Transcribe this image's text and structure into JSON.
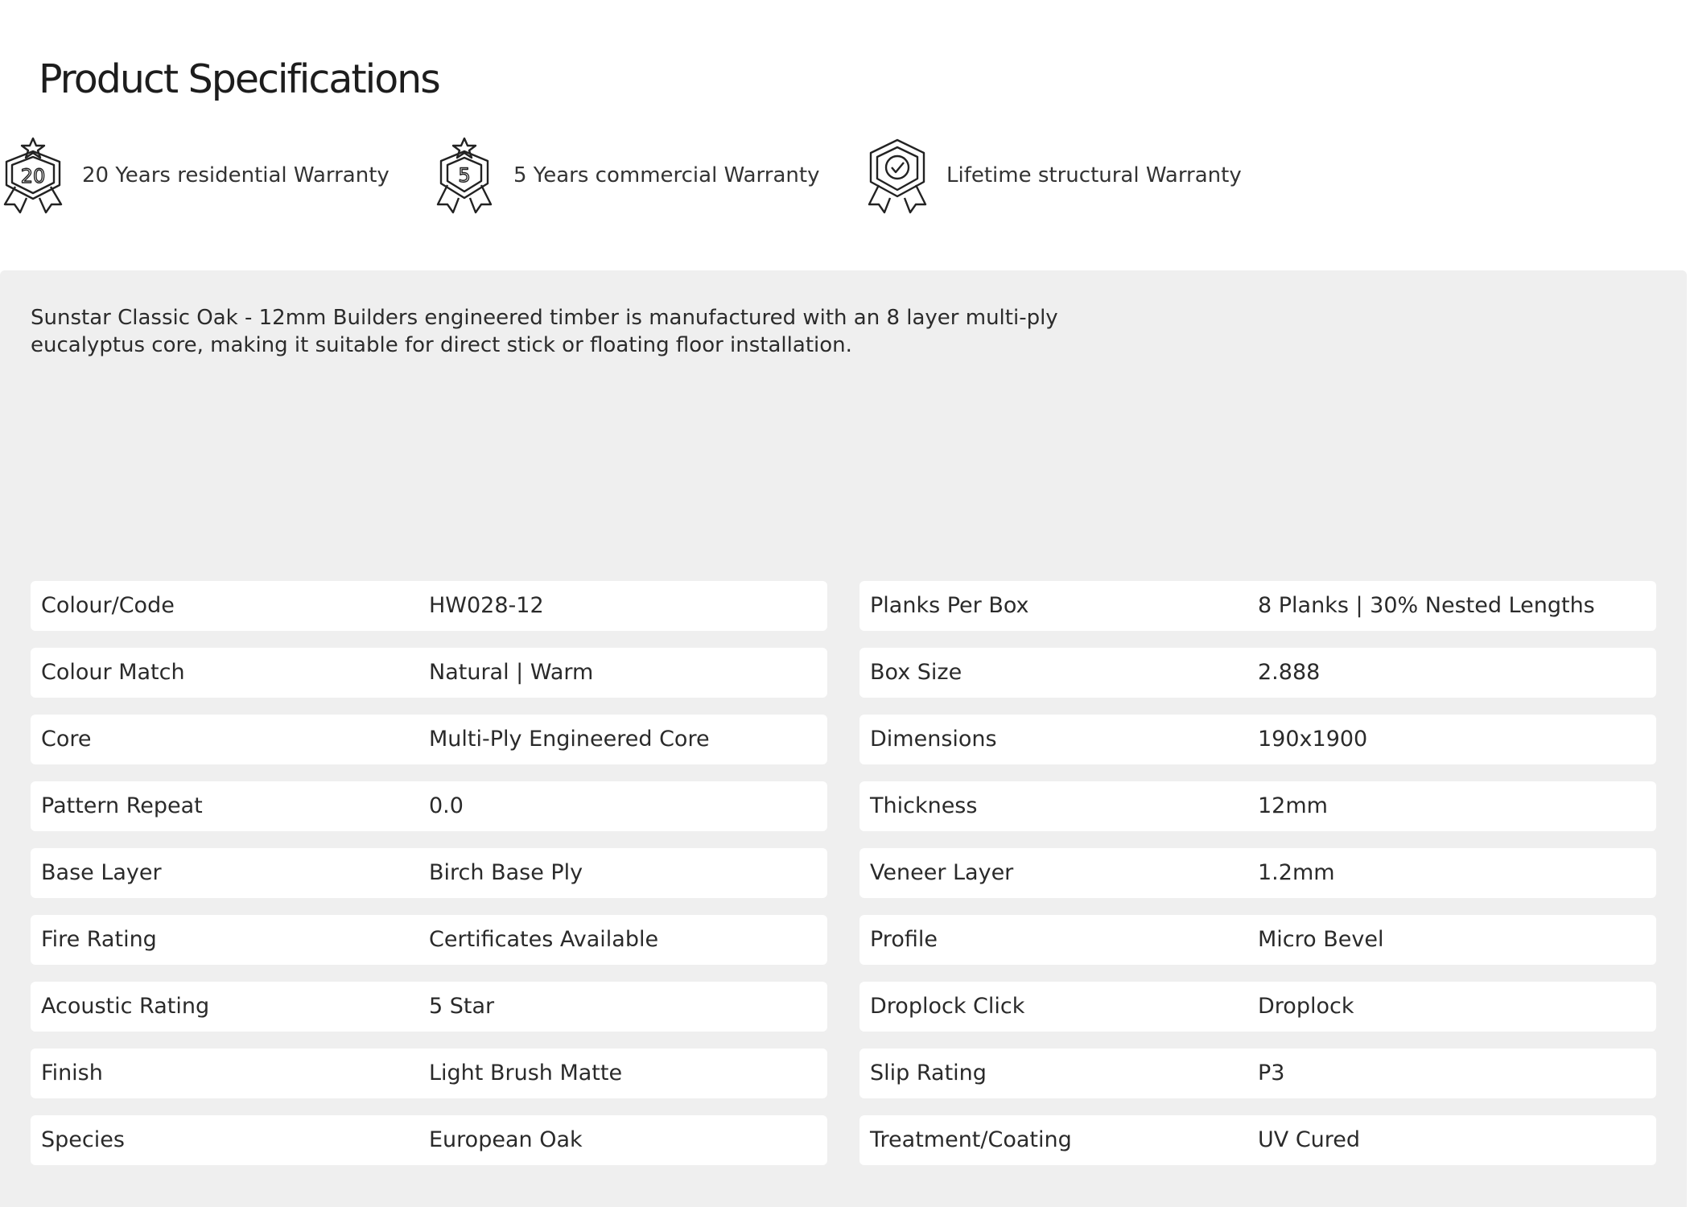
{
  "page": {
    "title": "Product Specifications"
  },
  "warranties": [
    {
      "icon": "ribbon-badge-20-icon",
      "badge_text": "20",
      "label": "20 Years residential Warranty"
    },
    {
      "icon": "ribbon-badge-5-icon",
      "badge_text": "5",
      "label": "5 Years commercial Warranty"
    },
    {
      "icon": "shield-check-badge-icon",
      "label": "Lifetime structural Warranty"
    }
  ],
  "description": "Sunstar Classic Oak - 12mm Builders engineered timber is manufactured with an 8 layer multi-ply eucalyptus core, making it suitable for direct stick or floating floor installation.",
  "specs": {
    "left": [
      {
        "label": "Colour/Code",
        "value": "HW028-12"
      },
      {
        "label": "Colour Match",
        "value": "Natural | Warm"
      },
      {
        "label": "Core",
        "value": "Multi-Ply Engineered Core"
      },
      {
        "label": "Pattern Repeat",
        "value": "0.0"
      },
      {
        "label": "Base Layer",
        "value": "Birch Base Ply"
      },
      {
        "label": "Fire Rating",
        "value": "Certificates Available"
      },
      {
        "label": "Acoustic Rating",
        "value": "5 Star"
      },
      {
        "label": "Finish",
        "value": "Light Brush Matte"
      },
      {
        "label": "Species",
        "value": "European Oak"
      }
    ],
    "right": [
      {
        "label": "Planks Per Box",
        "value": "8 Planks | 30% Nested Lengths"
      },
      {
        "label": "Box Size",
        "value": "2.888"
      },
      {
        "label": "Dimensions",
        "value": "190x1900"
      },
      {
        "label": "Thickness",
        "value": "12mm"
      },
      {
        "label": "Veneer Layer",
        "value": "1.2mm"
      },
      {
        "label": "Profile",
        "value": "Micro Bevel"
      },
      {
        "label": "Droplock Click",
        "value": "Droplock"
      },
      {
        "label": "Slip Rating",
        "value": "P3"
      },
      {
        "label": "Treatment/Coating",
        "value": "UV Cured"
      }
    ]
  },
  "colors": {
    "panel": "#efefef",
    "row": "#ffffff",
    "text": "#2a2a2a"
  }
}
